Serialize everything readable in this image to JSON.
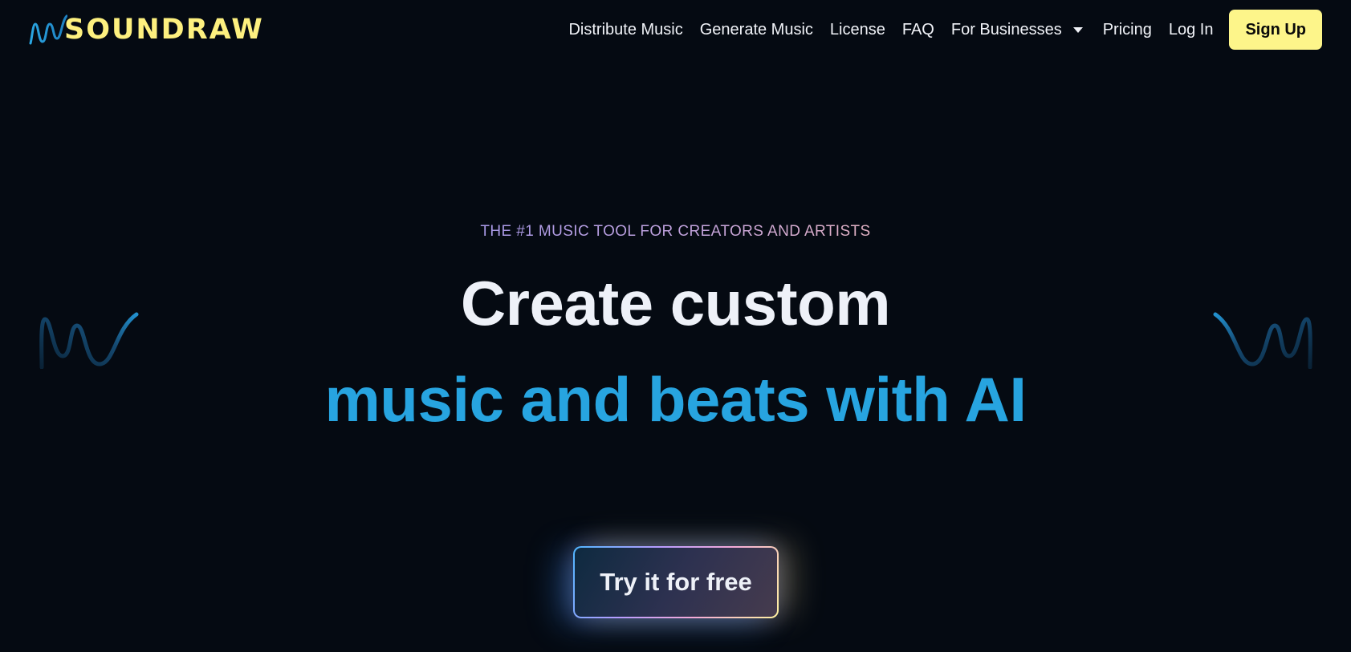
{
  "header": {
    "logo_text": "SOUNDRAW",
    "nav": {
      "distribute": "Distribute Music",
      "generate": "Generate Music",
      "license": "License",
      "faq": "FAQ",
      "businesses": "For Businesses",
      "pricing": "Pricing",
      "login": "Log In",
      "signup": "Sign Up"
    }
  },
  "hero": {
    "tagline": "THE #1 MUSIC TOOL FOR CREATORS AND ARTISTS",
    "headline_line1": "Create custom",
    "headline_line2": "music and beats with AI",
    "cta": "Try it for free"
  },
  "colors": {
    "background": "#050a12",
    "logo_yellow": "#fdf07f",
    "accent_blue": "#27a4e0",
    "signup_bg": "#fdf58a"
  },
  "icons": {
    "logo_mark": "wave-logo-icon",
    "dropdown": "chevron-down-icon",
    "decoration": "wave-squiggle-icon"
  }
}
